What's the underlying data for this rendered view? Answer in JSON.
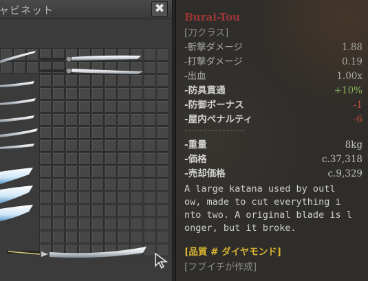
{
  "cabinet": {
    "title": "ャビネット",
    "close_label": "✖"
  },
  "tooltip": {
    "name": "Burai-Tou",
    "class": "[刀クラス]",
    "stats": [
      {
        "label": "-斬撃ダメージ",
        "value": "1.88",
        "style": "dim"
      },
      {
        "label": "-打撃ダメージ",
        "value": "0.19",
        "style": "dim"
      },
      {
        "label": "-出血",
        "value": "1.00x",
        "style": "dim"
      },
      {
        "label": "-防具貫通",
        "value": "+10%",
        "style": "pos"
      },
      {
        "label": "-防御ボーナス",
        "value": "-1",
        "style": "neg"
      },
      {
        "label": "-屋内ペナルティ",
        "value": "-6",
        "style": "neg"
      }
    ],
    "separator": "----------------",
    "props": [
      {
        "label": "-重量",
        "value": "8kg"
      },
      {
        "label": "-価格",
        "value": "c.37,318"
      },
      {
        "label": "-売却価格",
        "value": "c.9,329"
      }
    ],
    "description": "A large katana used by outl\now, made to cut everything i\nnto two. A original blade is l\nonger, but it broke.",
    "quality": "[品質 # ダイヤモンド]",
    "maker": "[フブイチが作成]"
  }
}
